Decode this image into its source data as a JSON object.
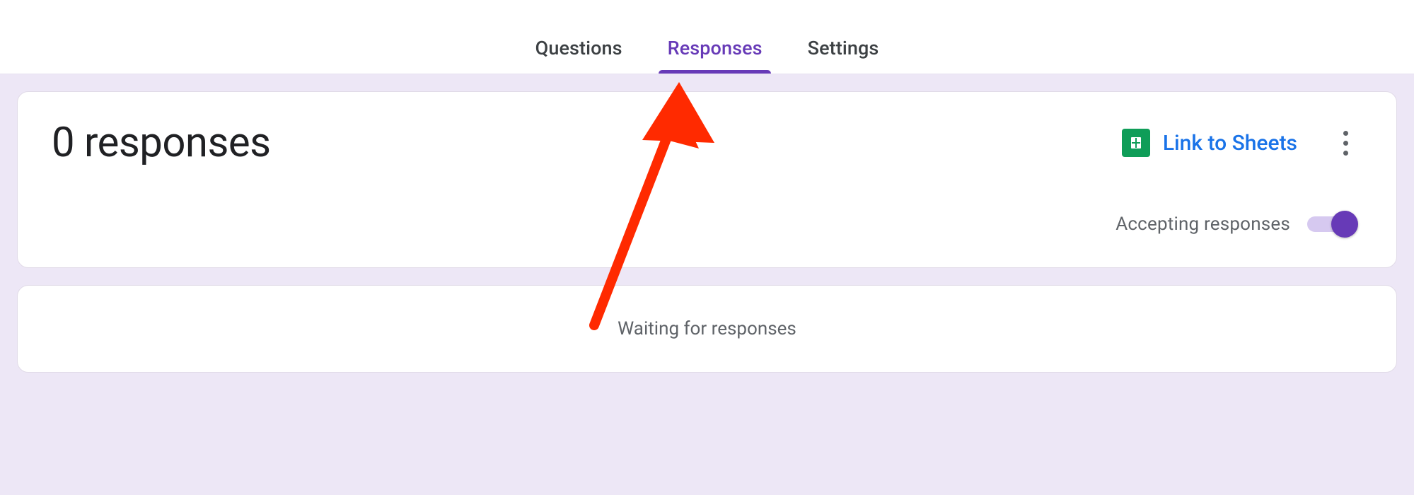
{
  "tabs": {
    "questions": {
      "label": "Questions",
      "active": false
    },
    "responses": {
      "label": "Responses",
      "active": true
    },
    "settings": {
      "label": "Settings",
      "active": false
    }
  },
  "main": {
    "responses_count_text": "0 responses",
    "link_to_sheets_label": "Link to Sheets",
    "accepting_responses_label": "Accepting responses",
    "accepting_responses_on": true,
    "waiting_text": "Waiting for responses"
  },
  "colors": {
    "accent": "#673ab7",
    "link": "#1a73e8",
    "sheets_green": "#0f9d58",
    "canvas_bg": "#ede7f6",
    "muted_text": "#5f6368"
  }
}
